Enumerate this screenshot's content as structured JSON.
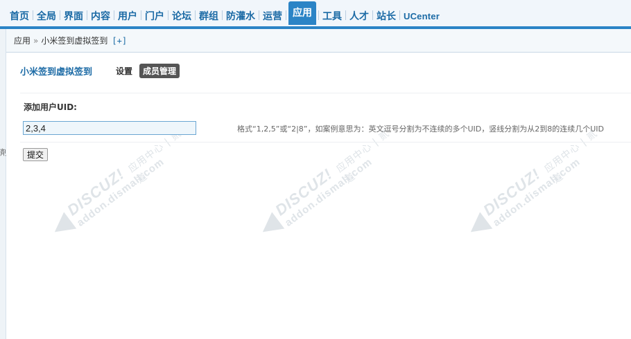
{
  "nav": {
    "tabs": [
      "首页",
      "全局",
      "界面",
      "内容",
      "用户",
      "门户",
      "论坛",
      "群组",
      "防灌水",
      "运营",
      "应用",
      "工具",
      "人才",
      "站长",
      "UCenter"
    ],
    "active": "应用",
    "accent": "#2b84c6"
  },
  "breadcrumb": {
    "root": "应用",
    "sep": "»",
    "current": "小米签到虚拟签到",
    "add": "[+]"
  },
  "page": {
    "title": "小米签到虚拟签到",
    "tab_settings": "设置",
    "tab_members": "成员管理"
  },
  "form": {
    "label": "添加用户UID:",
    "value": "2,3,4",
    "tip": "格式“1,2,5”或“2|8”，如案例意思为：英文逗号分割为不连续的多个UID，竖线分割为从2到8的连续几个UID",
    "submit": "提交"
  },
  "watermark": {
    "brand": "DISCUZ!",
    "cn": "应用中心 | 贰道",
    "url": "addon.dismall.com"
  },
  "sidebar": {
    "glyph": "剤"
  }
}
